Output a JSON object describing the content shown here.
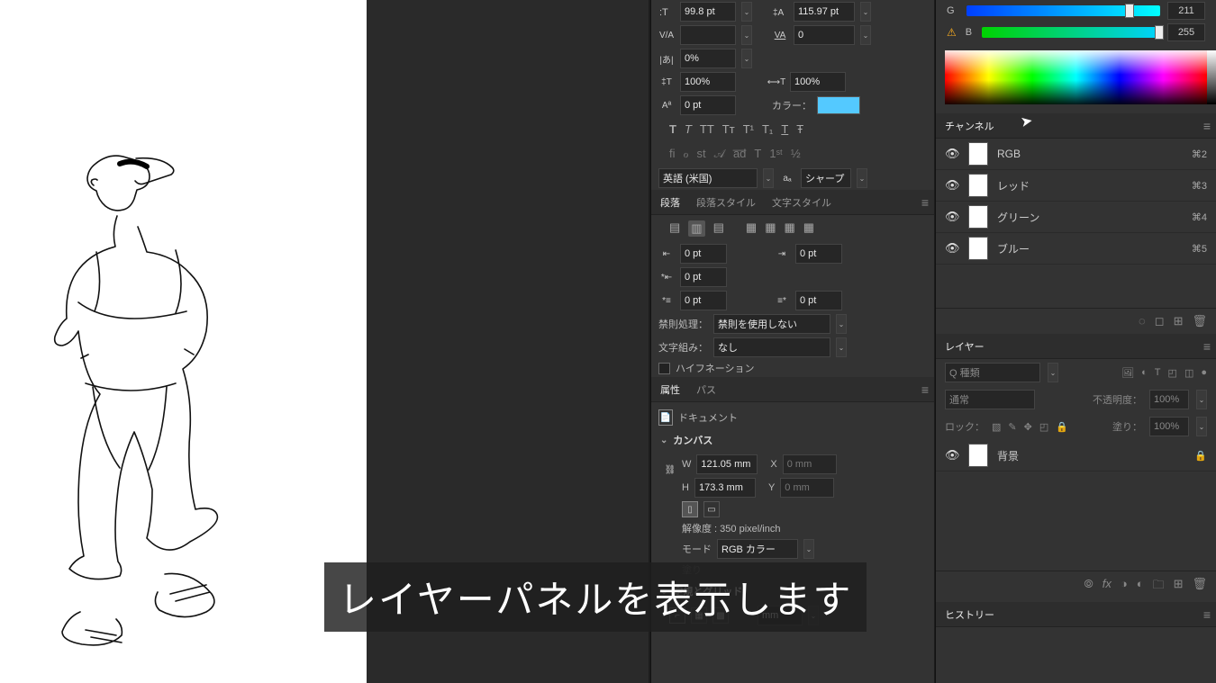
{
  "character": {
    "font_size": "99.8 pt",
    "leading": "115.97 pt",
    "kerning": "",
    "tracking": "0",
    "opacity": "0%",
    "hscale": "100%",
    "vscale": "100%",
    "baseline": "0 pt",
    "color_label": "カラー：",
    "color_hex": "#54c9ff",
    "language": "英語 (米国)",
    "aa": "シャープ"
  },
  "paragraph": {
    "tabs": [
      "段落",
      "段落スタイル",
      "文字スタイル"
    ],
    "indent_left": "0 pt",
    "indent_right": "0 pt",
    "indent_first": "0 pt",
    "space_before": "0 pt",
    "space_after": "0 pt",
    "kinsoku_label": "禁則処理：",
    "kinsoku_value": "禁則を使用しない",
    "mojikumi_label": "文字組み：",
    "mojikumi_value": "なし",
    "hyphenation": "ハイフネーション"
  },
  "properties": {
    "tabs": [
      "属性",
      "パス"
    ],
    "document": "ドキュメント",
    "canvas_section": "カンバス",
    "W": "W",
    "W_val": "121.05 mm",
    "H": "H",
    "H_val": "173.3 mm",
    "X": "X",
    "X_val": "0 mm",
    "Y": "Y",
    "Y_val": "0 mm",
    "resolution": "解像度 : 350 pixel/inch",
    "mode_label": "モード",
    "mode_value": "RGB カラー",
    "fill_label": "塗り",
    "rulers_section": "定規とグリッド",
    "ruler_unit": "mm"
  },
  "color_panel": {
    "G": "G",
    "G_val": "211",
    "B": "B",
    "B_val": "255"
  },
  "channels": {
    "title": "チャンネル",
    "items": [
      {
        "name": "RGB",
        "key": "⌘2"
      },
      {
        "name": "レッド",
        "key": "⌘3"
      },
      {
        "name": "グリーン",
        "key": "⌘4"
      },
      {
        "name": "ブルー",
        "key": "⌘5"
      }
    ]
  },
  "layers": {
    "title": "レイヤー",
    "filter_placeholder": "Q 種類",
    "blend": "通常",
    "opacity_label": "不透明度：",
    "opacity_val": "100%",
    "lock_label": "ロック：",
    "fill_label": "塗り：",
    "fill_val": "100%",
    "bg_layer": "背景"
  },
  "history": {
    "title": "ヒストリー"
  },
  "subtitle": "レイヤーパネルを表示します"
}
